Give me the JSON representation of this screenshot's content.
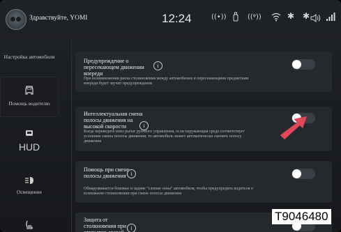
{
  "status_bar": {
    "greeting": "Здравствуйте, YOMI",
    "time": "12:24",
    "icons": [
      "avatar-icon",
      "wireless-charging-icon",
      "usb-drive-icon",
      "hotspot-icon",
      "wifi-icon",
      "bluetooth-off-icon",
      "bluetooth-icon",
      "volume-icon",
      "signal-icon"
    ]
  },
  "sidebar": {
    "items": [
      {
        "label": "Настройка автомобиля",
        "icon": "",
        "active": false
      },
      {
        "label": "Помощь водителю",
        "icon": "driver-assist-icon",
        "active": true
      },
      {
        "label": "HUD",
        "icon": "hud-icon",
        "active": false
      },
      {
        "label": "Освещение",
        "icon": "headlight-icon",
        "active": false
      },
      {
        "label": "",
        "icon": "seat-icon",
        "active": false
      }
    ]
  },
  "settings": [
    {
      "title": "Предупреждение о пересекающем движении впереди",
      "description": "При возникновении риска столкновения между автомобилем и пересекающими предметами впереди будет звучит предупреждение",
      "enabled": false
    },
    {
      "title": "Интеллектуальная смена полосы движения на высокой скорости",
      "description": "Когда переведите вниз рычаг рулевого управления, если окружающая среда соответствует условиям смены полосы движения, то автомобиль может автоматически сменять полосу движения",
      "enabled": false
    },
    {
      "title": "Помощь при смене полосы движения",
      "description": "Обнаруживается боковые и задние \"слепые зоны\" автомобиля, чтобы предупредить водителя о возможном столкновении при смене полосы движения",
      "enabled": false
    },
    {
      "title": "Защита от столкновения при открытии дверей",
      "description": "",
      "enabled": false
    }
  ],
  "watermark": "T9046480",
  "colors": {
    "background": "#1c1f22",
    "card": "#25282c",
    "toggle_track": "#3a3f45",
    "arrow": "#e0495a"
  }
}
